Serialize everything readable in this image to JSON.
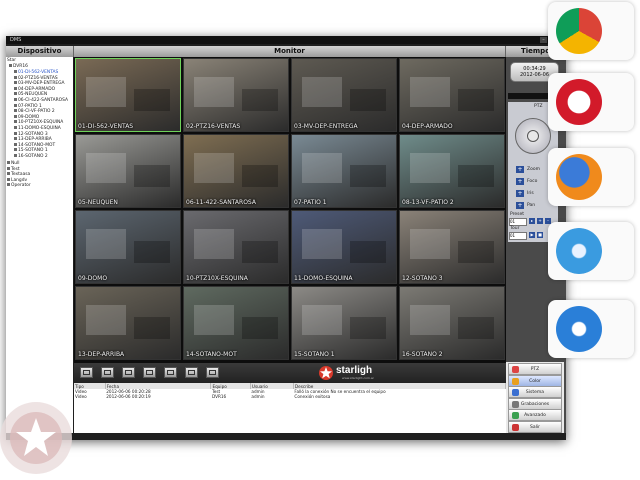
{
  "window": {
    "title": "DMS"
  },
  "headers": {
    "devices": "Dispositivo",
    "monitor": "Monitor",
    "time": "Tiempo"
  },
  "tree": {
    "root": "Star",
    "dvr": "DVR16",
    "cameras": [
      "01-DI-562-VENTAS",
      "02-PTZ16-VENTAS",
      "03-MV-DEP-ENTREGA",
      "04-DEP-ARMADO",
      "05-NEUQUEN",
      "06-CI-422-SANTAROSA",
      "07-PATIO 1",
      "08-CI-VF-PATIO 2",
      "09-DOMO",
      "10-PTZ10X-ESQUINA",
      "11-DOMO-ESQUINA",
      "12-SOTANO 3",
      "13-DEP-ARRIBA",
      "14-SOTANO-MOT",
      "15-SOTANO 1",
      "16-SOTANO 2"
    ],
    "groups": [
      "Null",
      "Test",
      "Textaasa",
      "Langdv",
      "Operator"
    ]
  },
  "cameras": [
    {
      "label": "01-DI-562-VENTAS",
      "color": "#7a6a55"
    },
    {
      "label": "02-PTZ16-VENTAS",
      "color": "#8a8377"
    },
    {
      "label": "03-MV-DEP-ENTREGA",
      "color": "#5e5a52"
    },
    {
      "label": "04-DEP-ARMADO",
      "color": "#6e6a60"
    },
    {
      "label": "05-NEUQUEN",
      "color": "#9a9a96"
    },
    {
      "label": "06-11-422-SANTAROSA",
      "color": "#7f6e52"
    },
    {
      "label": "07-PATIO 1",
      "color": "#7a8a94"
    },
    {
      "label": "08-13-VF-PATIO 2",
      "color": "#6f8c8a"
    },
    {
      "label": "09-DOMO",
      "color": "#5c6670"
    },
    {
      "label": "10-PTZ10X-ESQUINA",
      "color": "#6a6a6e"
    },
    {
      "label": "11-DOMO-ESQUINA",
      "color": "#4e5a78"
    },
    {
      "label": "12-SOTANO 3",
      "color": "#8a8278"
    },
    {
      "label": "13-DEP-ARRIBA",
      "color": "#6a6458"
    },
    {
      "label": "14-SOTANO-MOT",
      "color": "#5f6a60"
    },
    {
      "label": "15-SOTANO 1",
      "color": "#8c8a86"
    },
    {
      "label": "16-SOTANO 2",
      "color": "#7c7a74"
    }
  ],
  "brand": {
    "name": "starligh",
    "tagline": "www.starlight.com.ar"
  },
  "clock": {
    "time": "00:34:29",
    "date": "2012-06-06"
  },
  "ptz": {
    "title": "PTZ",
    "zoom": "Zoom",
    "focus": "Foco",
    "iris": "Iris",
    "pan": "Pan",
    "preset_label": "Preset",
    "preset_value": "01",
    "tour_label": "Tour",
    "tour_value": "01"
  },
  "events": {
    "columns": [
      "Tipo",
      "Fecha",
      "Equipo",
      "Usuario",
      "Describe"
    ],
    "rows": [
      [
        "Video",
        "2012-06-06 00:20:28",
        "Test",
        "admin",
        "Falló la conexión No se encuentra el equipo"
      ],
      [
        "Video",
        "2012-06-06 00:20:19",
        "DVR16",
        "admin",
        "Conexión exitosa"
      ]
    ]
  },
  "menu": [
    "PTZ",
    "Color",
    "Sistema",
    "Grabaciones",
    "Avanzado",
    "Salir"
  ],
  "colors": {
    "accent": "#2b4f9a",
    "panel": "#4a4a4a",
    "selected": "#2a55c8"
  },
  "browsers": [
    "chrome-icon",
    "opera-icon",
    "firefox-icon",
    "safari-icon",
    "internet-explorer-icon"
  ]
}
